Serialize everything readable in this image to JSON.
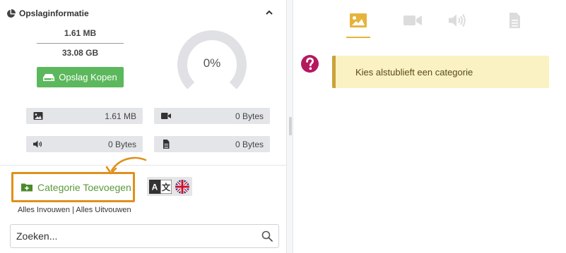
{
  "storage": {
    "title": "Opslaginformatie",
    "used": "1.61 MB",
    "total": "33.08 GB",
    "buy_label": "Opslag Kopen",
    "percent_label": "0%",
    "percent_value": 0,
    "stats": [
      {
        "icon": "image-icon",
        "value": "1.61 MB"
      },
      {
        "icon": "video-icon",
        "value": "0 Bytes"
      },
      {
        "icon": "audio-icon",
        "value": "0 Bytes"
      },
      {
        "icon": "document-icon",
        "value": "0 Bytes"
      }
    ]
  },
  "category": {
    "add_label": "Categorie Toevoegen",
    "expand_all": "Alles Invouwen",
    "separator": "|",
    "collapse_all": "Alles Uitvouwen"
  },
  "search": {
    "placeholder": "Zoeken..."
  },
  "media_tabs": [
    {
      "icon": "image-icon",
      "active": true
    },
    {
      "icon": "video-icon",
      "active": false
    },
    {
      "icon": "audio-icon",
      "active": false
    },
    {
      "icon": "document-icon",
      "active": false
    }
  ],
  "message": {
    "text": "Kies alstublieft een categorie"
  },
  "colors": {
    "accent_green": "#5cb85c",
    "highlight_orange": "#e0901b",
    "active_tab": "#e6b43c",
    "alert_bg": "#faf2c2",
    "question_icon": "#b5185f"
  }
}
